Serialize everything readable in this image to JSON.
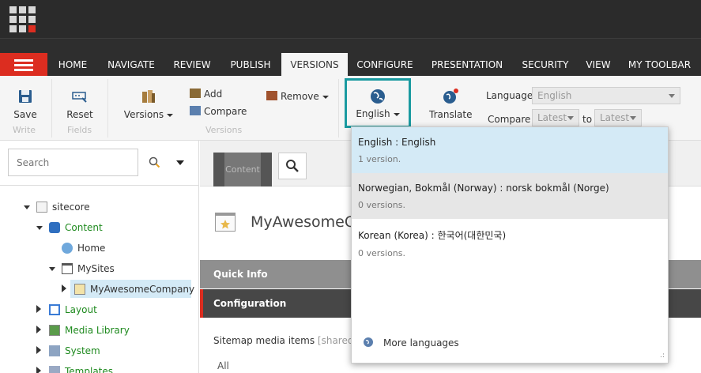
{
  "nav": {
    "tabs": [
      "HOME",
      "NAVIGATE",
      "REVIEW",
      "PUBLISH",
      "VERSIONS",
      "CONFIGURE",
      "PRESENTATION",
      "SECURITY",
      "VIEW",
      "MY TOOLBAR"
    ],
    "active_tab": "VERSIONS"
  },
  "ribbon": {
    "save": "Save",
    "write_caption": "Write",
    "reset": "Reset",
    "fields_caption": "Fields",
    "versions": "Versions",
    "add": "Add",
    "compare": "Compare",
    "remove": "Remove",
    "versions_caption": "Versions",
    "english_button": "English",
    "translate": "Translate",
    "language_label": "Language",
    "language_value": "English",
    "compare_label": "Compare",
    "compare_from": "Latest",
    "to_label": "to",
    "compare_to": "Latest"
  },
  "search": {
    "placeholder": "Search"
  },
  "tree": {
    "sitecore": "sitecore",
    "content": "Content",
    "home": "Home",
    "mysites": "MySites",
    "company": "MyAwesomeCompany",
    "layout": "Layout",
    "media": "Media Library",
    "system": "System",
    "templates": "Templates"
  },
  "content": {
    "tab_label": "Content",
    "item_title": "MyAwesomeCo",
    "quick_info": "Quick Info",
    "configuration": "Configuration",
    "field_label": "Sitemap media items",
    "shared_tag": "[shared]:",
    "field_value": "All"
  },
  "dropdown": {
    "items": [
      {
        "name": "English : English",
        "sub": "1 version."
      },
      {
        "name": "Norwegian, Bokmål (Norway) : norsk bokmål (Norge)",
        "sub": "0 versions."
      },
      {
        "name": "Korean (Korea) : 한국어(대한민국)",
        "sub": "0 versions."
      }
    ],
    "more": "More languages"
  },
  "colors": {
    "accent_red": "#dc2d20",
    "highlight_teal": "#1a9aa0",
    "tree_green": "#1f8a1f",
    "selected_blue": "#d4eaf6"
  }
}
